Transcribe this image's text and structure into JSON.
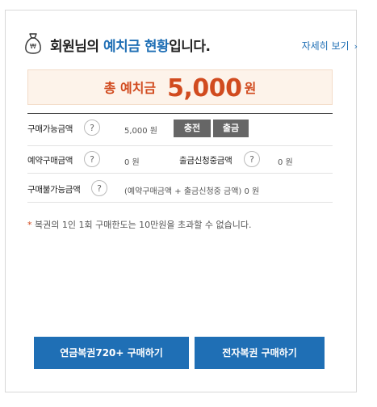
{
  "header": {
    "title_prefix": "회원님의 ",
    "title_highlight": "예치금 현황",
    "title_suffix": "입니다.",
    "detail_link": "자세히 보기",
    "detail_chevron": "›",
    "icon": "money-bag-icon"
  },
  "total": {
    "label": "총 예치금",
    "amount": "5,000",
    "unit": "원"
  },
  "rows": {
    "available_label": "구매가능금액",
    "available_value": "5,000 원",
    "charge_button": "충전",
    "withdraw_button": "출금",
    "reserved_label": "예약구매금액",
    "reserved_value": "0 원",
    "withdraw_pending_label": "출금신청중금액",
    "withdraw_pending_value": "0 원",
    "unavailable_label": "구매불가능금액",
    "unavailable_value": "(예약구매금액 + 출금신청중 금액)  0 원",
    "help_glyph": "?"
  },
  "notice": {
    "star": "*",
    "text": " 복권의 1인 1회 구매한도는 10만원을 초과할 수 없습니다."
  },
  "buttons": {
    "pension_lottery": "연금복권720+ 구매하기",
    "e_lottery": "전자복권 구매하기"
  },
  "colors": {
    "accent_blue": "#1f6fb5",
    "accent_red": "#d14b1f",
    "total_bg": "#fdf3ea",
    "gray_button": "#666666"
  }
}
